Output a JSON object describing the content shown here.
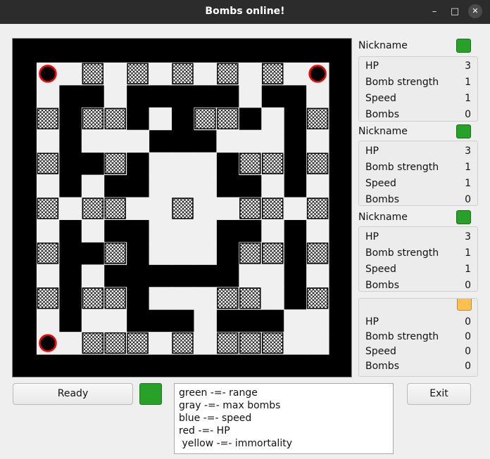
{
  "window": {
    "title": "Bombs online!",
    "minimize": "–",
    "maximize": "□",
    "close": "✕"
  },
  "colors": {
    "wall": "#000000",
    "floor": "#f0f0f0",
    "crate_fill": "#ffffff",
    "crate_hatch": "#000000",
    "player_ring": "#ff0000",
    "player_active": "#27a127",
    "player_empty": "#ffc04d"
  },
  "board": {
    "columns": 15,
    "rows": 15,
    "cells_legend": {
      "#": "wall",
      ".": "floor",
      "x": "crate",
      "p": "player"
    },
    "cells": [
      "###############",
      "#p.x.x.x.x.x.p#",
      "#.##.#####.##.#",
      "#x#xx#.#xx#.#x#",
      "#.#...###...#.#",
      "#x##x#...#xx#x#",
      "#.#.##...##.#.#",
      "#x.xx..x..xx.x#",
      "#.#.##...##.#.#",
      "#x##x#...#xx#x#",
      "#.#.######..#.#",
      "#x#xx#...xx.#x#",
      "#.#..###.###..#",
      "#p.xxx.x.xxx..#",
      "###############"
    ]
  },
  "players": [
    {
      "name": "Nickname",
      "color": "#27a127",
      "stats": [
        {
          "label": "HP",
          "value": "3"
        },
        {
          "label": "Bomb strength",
          "value": "1"
        },
        {
          "label": "Speed",
          "value": "1"
        },
        {
          "label": "Bombs",
          "value": "0"
        }
      ]
    },
    {
      "name": "Nickname",
      "color": "#27a127",
      "stats": [
        {
          "label": "HP",
          "value": "3"
        },
        {
          "label": "Bomb strength",
          "value": "1"
        },
        {
          "label": "Speed",
          "value": "1"
        },
        {
          "label": "Bombs",
          "value": "0"
        }
      ]
    },
    {
      "name": "Nickname",
      "color": "#27a127",
      "stats": [
        {
          "label": "HP",
          "value": "3"
        },
        {
          "label": "Bomb strength",
          "value": "1"
        },
        {
          "label": "Speed",
          "value": "1"
        },
        {
          "label": "Bombs",
          "value": "0"
        }
      ]
    },
    {
      "name": "",
      "color": "#ffc04d",
      "stats": [
        {
          "label": "HP",
          "value": "0"
        },
        {
          "label": "Bomb strength",
          "value": "0"
        },
        {
          "label": "Speed",
          "value": "0"
        },
        {
          "label": "Bombs",
          "value": "0"
        }
      ]
    }
  ],
  "controls": {
    "ready_label": "Ready",
    "ready_color": "#27a127",
    "exit_label": "Exit"
  },
  "legend": [
    "green -=- range",
    "gray -=- max bombs",
    "blue -=- speed",
    "red -=- HP",
    " yellow -=- immortality"
  ]
}
